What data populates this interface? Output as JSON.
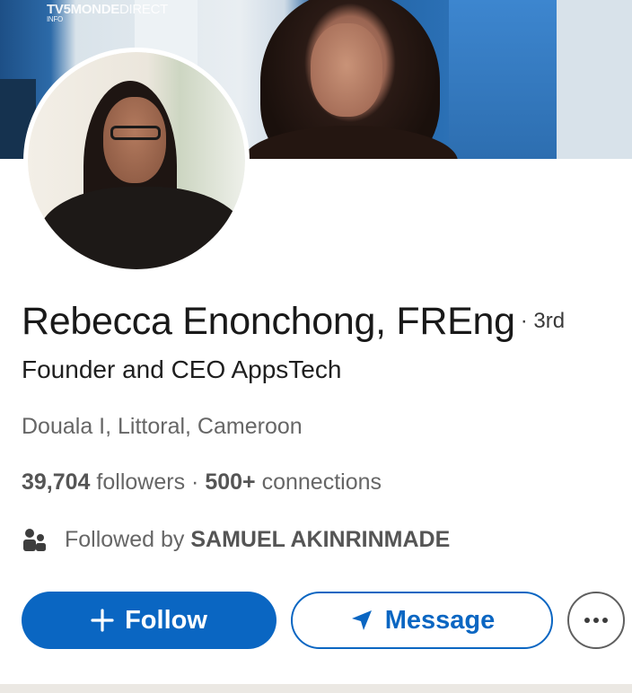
{
  "banner": {
    "channel_logo": "TV5MONDE",
    "channel_logo_suffix": "DIRECT",
    "channel_sub": "INFO"
  },
  "profile": {
    "name": "Rebecca Enonchong, FREng",
    "degree": "· 3rd",
    "headline": "Founder and CEO AppsTech",
    "location": "Douala I, Littoral, Cameroon",
    "followers_count": "39,704",
    "followers_label": "followers",
    "separator": "·",
    "connections_count": "500+",
    "connections_label": "connections",
    "followed_by_prefix": "Followed by",
    "followed_by_name": "SAMUEL AKINRINMADE"
  },
  "actions": {
    "follow_label": "Follow",
    "message_label": "Message"
  },
  "icons": {
    "follow": "plus-icon",
    "message": "send-icon",
    "more": "more-horizontal-icon",
    "followed": "people-icon"
  },
  "colors": {
    "primary": "#0a66c2",
    "text_primary": "#191919",
    "text_secondary": "#666666"
  }
}
